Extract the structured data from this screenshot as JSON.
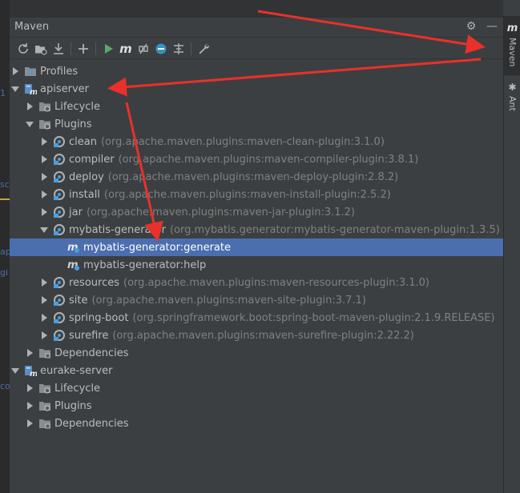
{
  "editor": {
    "gutter_fragments": [
      "1",
      "sc",
      "ap",
      "gi",
      "co"
    ]
  },
  "panel": {
    "title": "Maven",
    "header_icons": [
      "gear-icon",
      "minimize-icon"
    ]
  },
  "toolbar": {
    "buttons": [
      {
        "name": "reimport-icon"
      },
      {
        "name": "generate-sources-icon"
      },
      {
        "name": "download-sources-icon"
      },
      {
        "name": "add-project-icon"
      },
      {
        "name": "run-icon"
      },
      {
        "name": "execute-goal-icon"
      },
      {
        "name": "toggle-offline-icon"
      },
      {
        "name": "skip-tests-icon"
      },
      {
        "name": "show-dependencies-icon"
      },
      {
        "name": "settings-wrench-icon"
      }
    ]
  },
  "side_stripe": {
    "maven_label": "Maven",
    "ant_label": "Ant",
    "maven_glyph": "m"
  },
  "tree": {
    "profiles": "Profiles",
    "project1": "apiserver",
    "lifecycle": "Lifecycle",
    "plugins": "Plugins",
    "plugin_items": [
      {
        "name": "clean",
        "detail": "(org.apache.maven.plugins:maven-clean-plugin:3.1.0)"
      },
      {
        "name": "compiler",
        "detail": "(org.apache.maven.plugins:maven-compiler-plugin:3.8.1)"
      },
      {
        "name": "deploy",
        "detail": "(org.apache.maven.plugins:maven-deploy-plugin:2.8.2)"
      },
      {
        "name": "install",
        "detail": "(org.apache.maven.plugins:maven-install-plugin:2.5.2)"
      },
      {
        "name": "jar",
        "detail": "(org.apache.maven.plugins:maven-jar-plugin:3.1.2)"
      },
      {
        "name": "mybatis-generator",
        "detail": "(org.mybatis.generator:mybatis-generator-maven-plugin:1.3.5)"
      },
      {
        "name": "resources",
        "detail": "(org.apache.maven.plugins:maven-resources-plugin:3.1.0)"
      },
      {
        "name": "site",
        "detail": "(org.apache.maven.plugins:maven-site-plugin:3.7.1)"
      },
      {
        "name": "spring-boot",
        "detail": "(org.springframework.boot:spring-boot-maven-plugin:2.1.9.RELEASE)"
      },
      {
        "name": "surefire",
        "detail": "(org.apache.maven.plugins:maven-surefire-plugin:2.22.2)"
      }
    ],
    "goals": [
      "mybatis-generator:generate",
      "mybatis-generator:help"
    ],
    "dependencies": "Dependencies",
    "project2": "eurake-server",
    "project2_children": [
      "Lifecycle",
      "Plugins",
      "Dependencies"
    ]
  },
  "colors": {
    "background": "#3c3f41",
    "selection": "#4b6eaf",
    "annotation_arrow": "#e8312a",
    "run_green": "#59a869",
    "plugin_blue": "#4a9ee0"
  }
}
